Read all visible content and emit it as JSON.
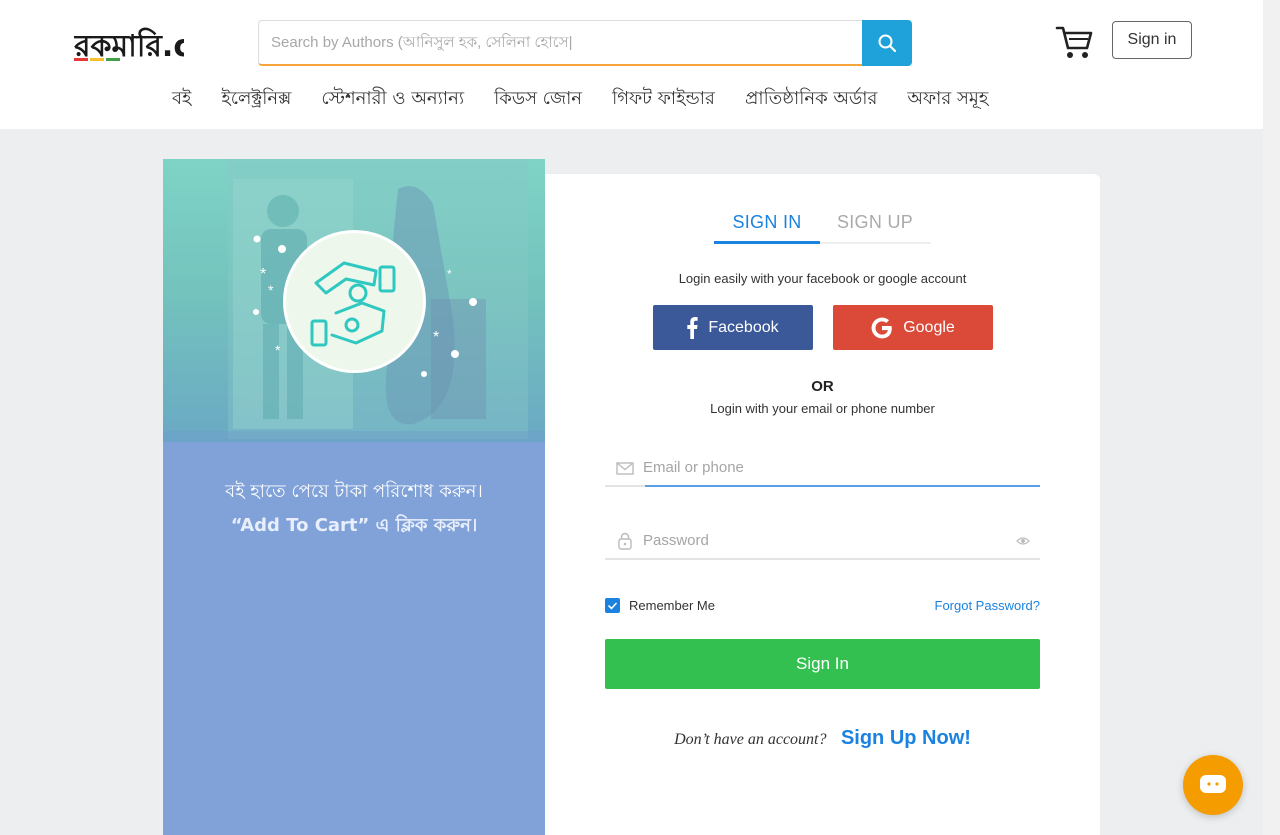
{
  "header": {
    "logo_text": "রকমারি.com",
    "search_placeholder": "Search by Authors (আনিসুল হক, সেলিনা হোসে|",
    "signin_label": "Sign in",
    "nav": [
      "বই",
      "ইলেক্ট্রনিক্স",
      "স্টেশনারী ও অন্যান্য",
      "কিডস জোন",
      "গিফট ফাইন্ডার",
      "প্রাতিষ্ঠানিক অর্ডার",
      "অফার সমূহ"
    ]
  },
  "promo": {
    "line1": "বই হাতে পেয়ে টাকা পরিশোধ করুন।",
    "line2": "“Add To Cart” এ ক্লিক করুন।"
  },
  "login": {
    "tab_signin": "SIGN IN",
    "tab_signup": "SIGN UP",
    "social_hint": "Login easily with your facebook or google account",
    "facebook_label": "Facebook",
    "google_label": "Google",
    "or_label": "OR",
    "email_hint": "Login with your email or phone number",
    "email_placeholder": "Email or phone",
    "password_placeholder": "Password",
    "remember_label": "Remember Me",
    "forgot_label": "Forgot Password?",
    "submit_label": "Sign In",
    "no_account_text": "Don’t have an account?",
    "signup_now_label": "Sign Up Now!"
  },
  "colors": {
    "accent_blue": "#1b82e0",
    "facebook": "#3b5998",
    "google": "#db4a39",
    "signin_green": "#34c050",
    "search_blue": "#1ea2d9",
    "chat_orange": "#f59c00"
  }
}
